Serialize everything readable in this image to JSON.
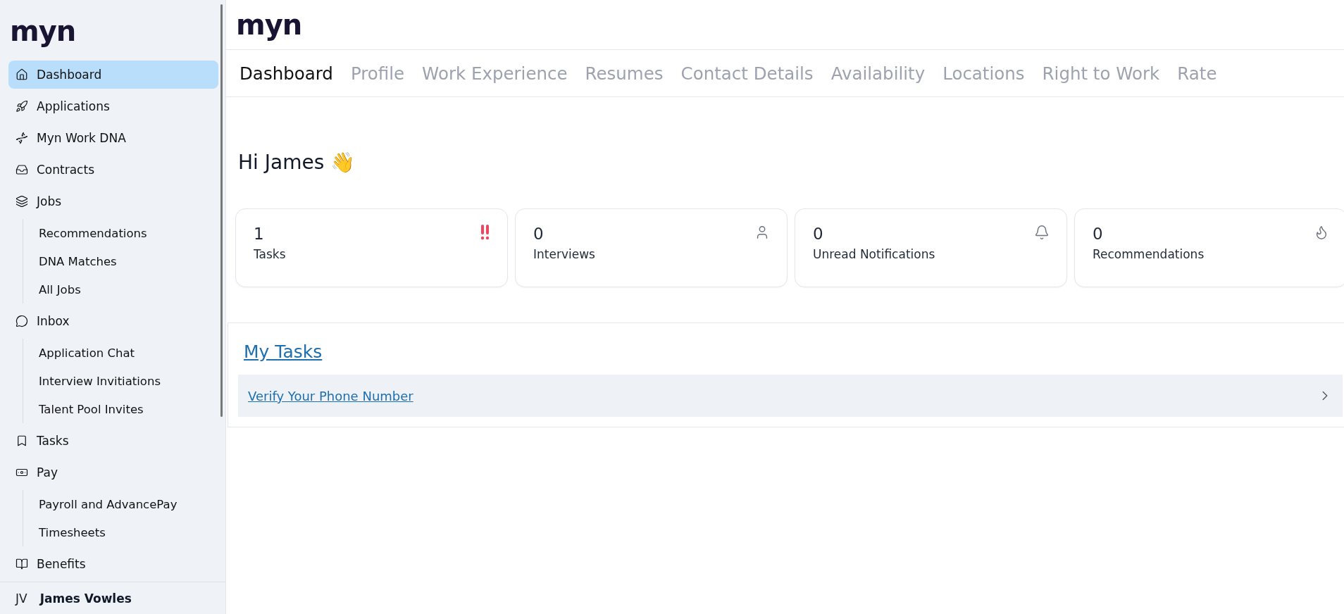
{
  "sidebar": {
    "logo": "myn",
    "items": [
      {
        "label": "Dashboard",
        "selected": true
      },
      {
        "label": "Applications",
        "selected": false
      },
      {
        "label": "Myn Work DNA",
        "selected": false
      },
      {
        "label": "Contracts",
        "selected": false
      },
      {
        "label": "Jobs",
        "selected": false,
        "children": [
          {
            "label": "Recommendations",
            "selected": false
          },
          {
            "label": "DNA Matches",
            "selected": false
          },
          {
            "label": "All Jobs",
            "selected": false
          }
        ]
      },
      {
        "label": "Inbox",
        "selected": false,
        "children": [
          {
            "label": "Application Chat",
            "selected": false
          },
          {
            "label": "Interview Invitiations",
            "selected": false
          },
          {
            "label": "Talent Pool Invites",
            "selected": false
          }
        ]
      },
      {
        "label": "Tasks",
        "selected": false
      },
      {
        "label": "Pay",
        "selected": false,
        "children": [
          {
            "label": "Payroll and AdvancePay",
            "selected": false
          },
          {
            "label": "Timesheets",
            "selected": false
          }
        ]
      },
      {
        "label": "Benefits",
        "selected": false
      }
    ],
    "user": {
      "initials": "JV",
      "name": "James Vowles"
    }
  },
  "header": {
    "logo": "myn"
  },
  "tabs": [
    {
      "label": "Dashboard",
      "selected": true
    },
    {
      "label": "Profile",
      "selected": false
    },
    {
      "label": "Work Experience",
      "selected": false
    },
    {
      "label": "Resumes",
      "selected": false
    },
    {
      "label": "Contact Details",
      "selected": false
    },
    {
      "label": "Availability",
      "selected": false
    },
    {
      "label": "Locations",
      "selected": false
    },
    {
      "label": "Right to Work",
      "selected": false
    },
    {
      "label": "Rate",
      "selected": false
    }
  ],
  "greeting": "Hi James 👋",
  "stats": [
    {
      "value": "1",
      "label": "Tasks"
    },
    {
      "value": "0",
      "label": "Interviews"
    },
    {
      "value": "0",
      "label": "Unread Notifications"
    },
    {
      "value": "0",
      "label": "Recommendations"
    }
  ],
  "my_tasks": {
    "title": "My Tasks",
    "tasks": [
      {
        "label": "Verify Your Phone Number"
      }
    ]
  }
}
